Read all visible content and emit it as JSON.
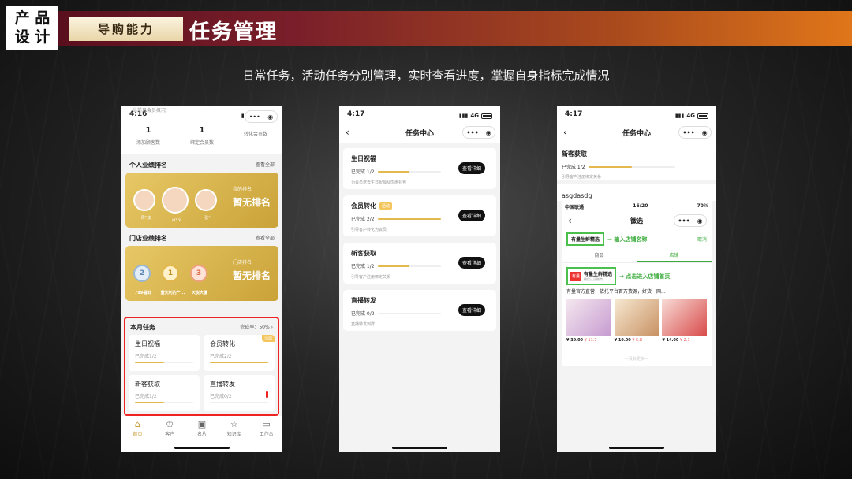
{
  "header": {
    "badge_line1": "产 品",
    "badge_line2": "设 计",
    "section": "导购能力",
    "title": "任务管理",
    "subtitle": "日常任务，活动任务分别管理，实时查看进度，掌握自身指标完成情况"
  },
  "colors": {
    "accent_gold": "#e3b84d",
    "highlight_red": "#e22222",
    "green_annotation": "#3aaa3a"
  },
  "phone1": {
    "caption": "当前月会员概况",
    "time": "4:16",
    "network": "4G",
    "stats": [
      {
        "num": "1",
        "label": "添加顾客数"
      },
      {
        "num": "1",
        "label": "绑定会员数"
      },
      {
        "num": "",
        "label": "转化会员数"
      }
    ],
    "personal": {
      "title": "个人业绩排名",
      "more": "查看全部",
      "names": [
        "周*炫",
        "卢*义",
        "张*"
      ],
      "rank_label": "我的排名",
      "rank_value": "暂无排名"
    },
    "store": {
      "title": "门店业绩排名",
      "more": "查看全部",
      "medals": [
        {
          "num": "2",
          "name": "799福田"
        },
        {
          "num": "1",
          "name": "暨天利的产..."
        },
        {
          "num": "3",
          "name": "天悦大厦"
        }
      ],
      "rank_label": "门店排名",
      "rank_value": "暂无排名"
    },
    "monthly": {
      "title": "本月任务",
      "rate": "完成率：50%",
      "cards": [
        {
          "title": "生日祝福",
          "status": "已完成1/2",
          "progress": 0.5,
          "tag": ""
        },
        {
          "title": "会员转化",
          "status": "已完成2/2",
          "progress": 1.0,
          "tag": "活动"
        },
        {
          "title": "新客获取",
          "status": "已完成1/2",
          "progress": 0.5,
          "tag": ""
        },
        {
          "title": "直播转发",
          "status": "已完成0/2",
          "progress": 0.0,
          "tag": ""
        }
      ]
    },
    "tabs": [
      {
        "label": "首页",
        "icon": "home-icon"
      },
      {
        "label": "客户",
        "icon": "crown-icon"
      },
      {
        "label": "名片",
        "icon": "card-icon"
      },
      {
        "label": "知识库",
        "icon": "book-icon"
      },
      {
        "label": "工作台",
        "icon": "desk-icon"
      }
    ]
  },
  "phone2": {
    "time": "4:17",
    "network": "4G",
    "nav_title": "任务中心",
    "tasks": [
      {
        "title": "生日祝福",
        "status": "已完成 1/2",
        "progress": 0.5,
        "desc": "为会员送去生日祝福及优惠礼包",
        "tag": "",
        "button": "查看详细"
      },
      {
        "title": "会员转化",
        "status": "已完成 2/2",
        "progress": 1.0,
        "desc": "引导客户转化为会员",
        "tag": "活动",
        "button": "查看详细"
      },
      {
        "title": "新客获取",
        "status": "已完成 1/2",
        "progress": 0.5,
        "desc": "引导客户注册绑定关系",
        "tag": "",
        "button": "查看详细"
      },
      {
        "title": "直播转发",
        "status": "已完成 0/2",
        "progress": 0.0,
        "desc": "直播转发到群",
        "tag": "",
        "button": "查看详细"
      }
    ]
  },
  "phone3": {
    "time": "4:17",
    "network": "4G",
    "nav_title": "任务中心",
    "top_task": {
      "title": "新客获取",
      "status": "已完成 1/2",
      "progress": 0.5,
      "desc": "引导客户注册绑定关系"
    },
    "shop_label": "asgdasdg",
    "inner": {
      "carrier": "中国联通",
      "time": "16:20",
      "battery": "70%",
      "title": "微选",
      "search_value": "有量生鲜精选",
      "search_note": "输入店铺名称",
      "cancel": "取消",
      "segments": [
        "商品",
        "店铺"
      ],
      "store_logo": "有量",
      "store_name": "有量生鲜精选",
      "store_sub": "微信认证微商",
      "store_note": "点击进入店铺首页",
      "store_desc": "有量官方直营，依托平台百万货源，好货一网...",
      "products": [
        {
          "price": "¥ 39.00",
          "old": "¥ 11.7"
        },
        {
          "price": "¥ 19.00",
          "old": "¥ 5.8"
        },
        {
          "price": "¥ 14.00",
          "old": "¥ 2.1"
        }
      ],
      "footer": "—没有更多—"
    }
  }
}
